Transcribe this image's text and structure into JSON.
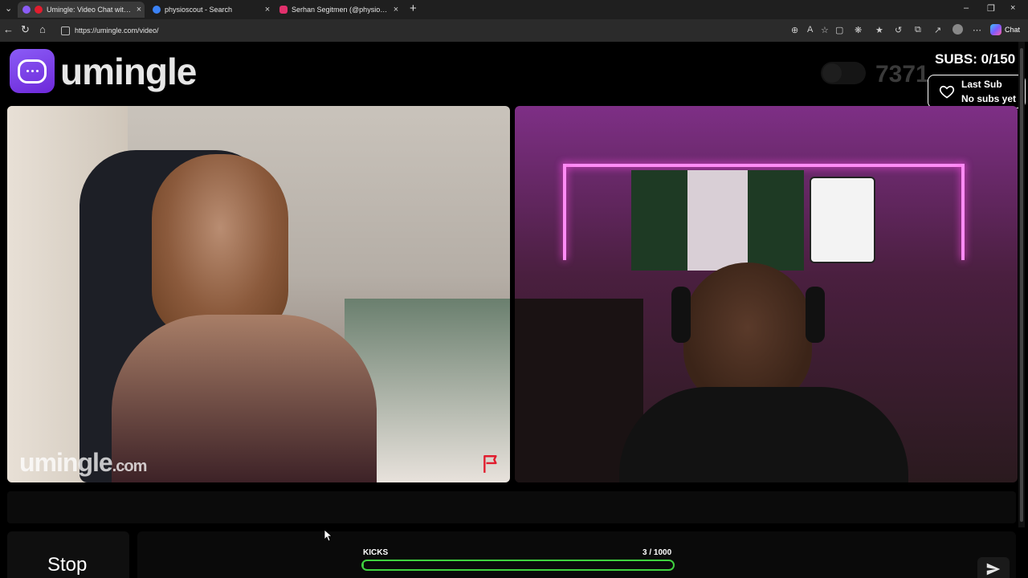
{
  "browser": {
    "tabs": [
      {
        "title": "Umingle: Video Chat with Stra",
        "active": true,
        "favicon_color": "#8b5cf6"
      },
      {
        "title": "physioscout - Search",
        "active": false,
        "favicon_color": "#3b82f6"
      },
      {
        "title": "Serhan Segitmen (@physioscout) ·",
        "active": false,
        "favicon_color": "#e1306c"
      }
    ],
    "new_tab": "+",
    "url": "https://umingle.com/video/",
    "chat_label": "Chat"
  },
  "header": {
    "brand": "umingle",
    "online_count": "7371 ",
    "subs_label": "SUBS: 0/150",
    "last_sub_title": "Last Sub",
    "last_sub_value": "No subs yet"
  },
  "video": {
    "watermark_main": "umingle",
    "watermark_tld": ".com"
  },
  "controls": {
    "stop_label": "Stop",
    "kicks_label": "KICKS",
    "kicks_current": "3",
    "kicks_separator": " / ",
    "kicks_total": "1000",
    "kicks_progress": 0.003
  },
  "colors": {
    "brand": "#8b5cf6",
    "progress": "#3fd13f",
    "report_flag": "#e11d2e"
  },
  "icons": [
    "chat-bubble-icon",
    "heart-icon",
    "flag-icon",
    "send-icon",
    "back-icon",
    "refresh-icon",
    "home-icon",
    "lock-icon"
  ]
}
